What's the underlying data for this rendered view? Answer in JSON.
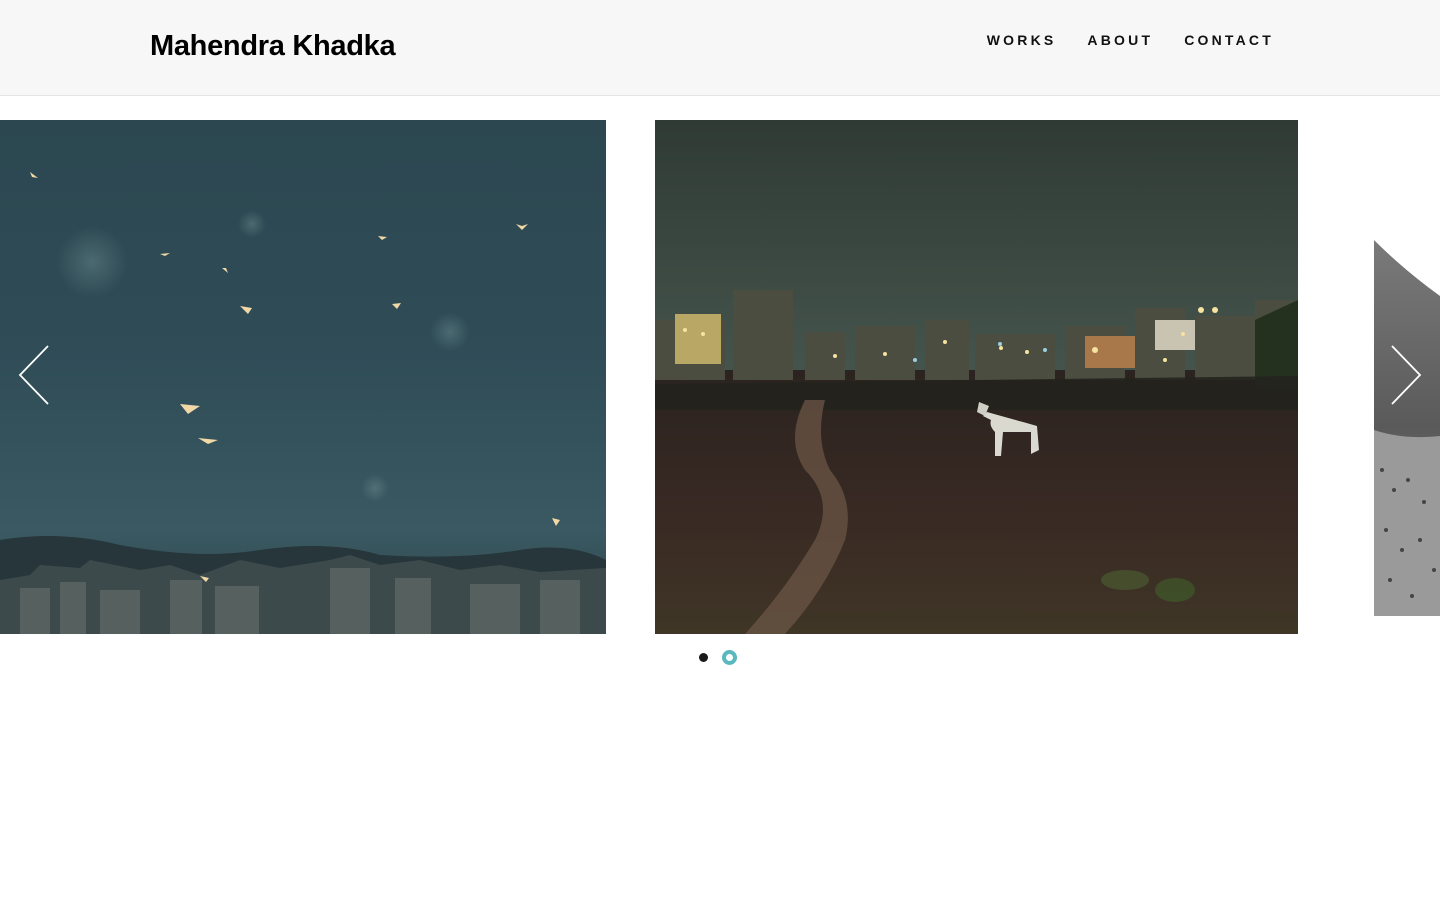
{
  "header": {
    "site_title": "Mahendra Khadka",
    "nav": [
      {
        "label": "WORKS"
      },
      {
        "label": "ABOUT"
      },
      {
        "label": "CONTACT"
      }
    ]
  },
  "slider": {
    "slides": [
      {
        "icon": "photo-birds-dusk-city"
      },
      {
        "icon": "photo-white-horse-night-city"
      },
      {
        "icon": "photo-bw-field-partial"
      }
    ],
    "prev_icon": "chevron-left-icon",
    "next_icon": "chevron-right-icon",
    "pagination": {
      "count": 2,
      "active_index": 1
    },
    "colors": {
      "active_dot": "#5bb8be",
      "inactive_dot": "#1a1a1a"
    }
  }
}
